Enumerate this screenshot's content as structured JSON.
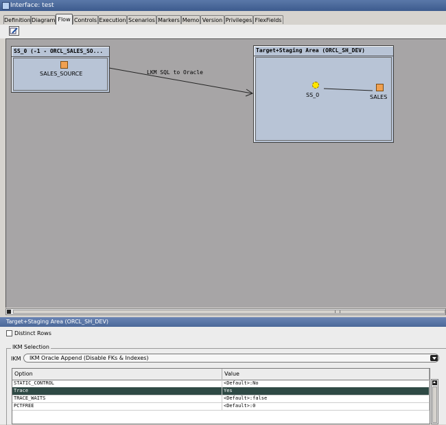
{
  "window": {
    "title": "Interface: test"
  },
  "tabs": [
    {
      "label": "Definition"
    },
    {
      "label": "Diagram"
    },
    {
      "label": "Flow"
    },
    {
      "label": "Controls"
    },
    {
      "label": "Execution"
    },
    {
      "label": "Scenarios"
    },
    {
      "label": "Markers"
    },
    {
      "label": "Memo"
    },
    {
      "label": "Version"
    },
    {
      "label": "Privileges"
    },
    {
      "label": "FlexFields"
    }
  ],
  "active_tab": "Flow",
  "flow": {
    "source_box": {
      "title": "SS_0 (-1 - ORCL_SALES_SO...",
      "item": "SALES_SOURCE"
    },
    "target_box": {
      "title": "Target+Staging Area (ORCL_SH_DEV)",
      "set_label": "SS_0",
      "target_label": "SALES"
    },
    "arrow_label": "LKM SQL to Oracle"
  },
  "panel": {
    "title": "Target+Staging Area (ORCL_SH_DEV)",
    "distinct_rows_label": "Distinct Rows",
    "distinct_rows_checked": false,
    "ikm_group_label": "IKM Selection",
    "ikm_label": "IKM",
    "ikm_value": "IKM Oracle Append (Disable FKs & Indexes)",
    "table": {
      "columns": [
        "Option",
        "Value"
      ],
      "rows": [
        {
          "option": "STATIC_CONTROL",
          "value": "<Default>:No"
        },
        {
          "option": "Trace",
          "value": "Yes"
        },
        {
          "option": "TRACE_WAITS",
          "value": "<Default>:false"
        },
        {
          "option": "PCTFREE",
          "value": "<Default>:0"
        }
      ],
      "selected_row": 1
    }
  }
}
